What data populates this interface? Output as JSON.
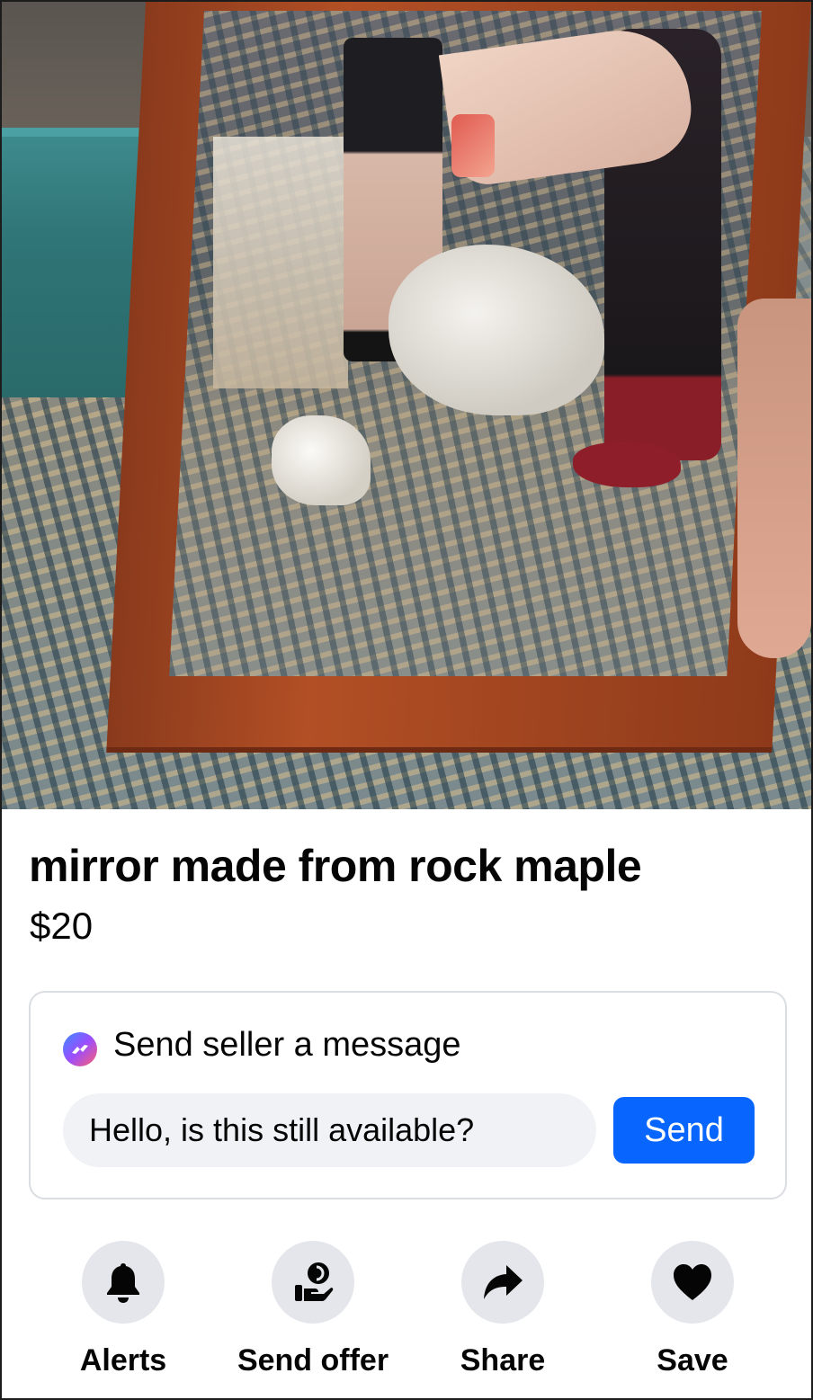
{
  "listing": {
    "photo_icon": "listing-photo-mirror",
    "title": "mirror made from rock maple",
    "price": "$20"
  },
  "message": {
    "icon": "messenger-icon",
    "heading": "Send seller a message",
    "input_value": "Hello, is this still available?",
    "send_label": "Send"
  },
  "actions": [
    {
      "icon": "bell-icon",
      "label": "Alerts"
    },
    {
      "icon": "send-offer-icon",
      "label": "Send offer"
    },
    {
      "icon": "share-arrow-icon",
      "label": "Share"
    },
    {
      "icon": "heart-icon",
      "label": "Save"
    }
  ],
  "colors": {
    "accent": "#0866ff",
    "action_circle": "#e4e6eb",
    "input_bg": "#f0f2f5",
    "card_border": "#dadde1"
  }
}
